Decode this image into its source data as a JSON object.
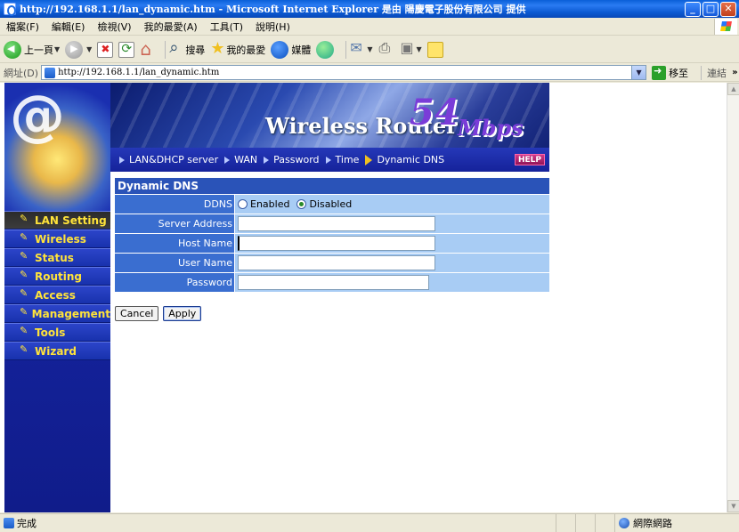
{
  "window": {
    "title": "http://192.168.1.1/lan_dynamic.htm - Microsoft Internet Explorer 是由 陽慶電子股份有限公司 提供"
  },
  "menu": [
    "檔案(F)",
    "編輯(E)",
    "檢視(V)",
    "我的最愛(A)",
    "工具(T)",
    "說明(H)"
  ],
  "toolbar": {
    "back_label": "上一頁",
    "search_label": "搜尋",
    "favorites_label": "我的最愛",
    "media_label": "媒體"
  },
  "address": {
    "label": "網址(D)",
    "url": "http://192.168.1.1/lan_dynamic.htm",
    "go_label": "移至",
    "links_label": "連結"
  },
  "banner": {
    "product_text": "Wireless Router",
    "speed": "54",
    "unit": "Mbps"
  },
  "tabs": [
    "LAN&DHCP server",
    "WAN",
    "Password",
    "Time",
    "Dynamic DNS"
  ],
  "active_tab_index": 4,
  "help_label": "HELP",
  "nav": {
    "items": [
      "LAN Setting",
      "Wireless",
      "Status",
      "Routing",
      "Access",
      "Management",
      "Tools",
      "Wizard"
    ],
    "active_index": 0
  },
  "form": {
    "title": "Dynamic DNS",
    "ddns_label": "DDNS",
    "enabled_label": "Enabled",
    "disabled_label": "Disabled",
    "ddns_value": "Disabled",
    "server_address_label": "Server Address",
    "server_address_value": "",
    "host_name_label": "Host Name",
    "host_name_value": "",
    "user_name_label": "User Name",
    "user_name_value": "",
    "password_label": "Password",
    "password_value": ""
  },
  "buttons": {
    "cancel": "Cancel",
    "apply": "Apply"
  },
  "status": {
    "text": "完成",
    "zone": "網際網路"
  }
}
